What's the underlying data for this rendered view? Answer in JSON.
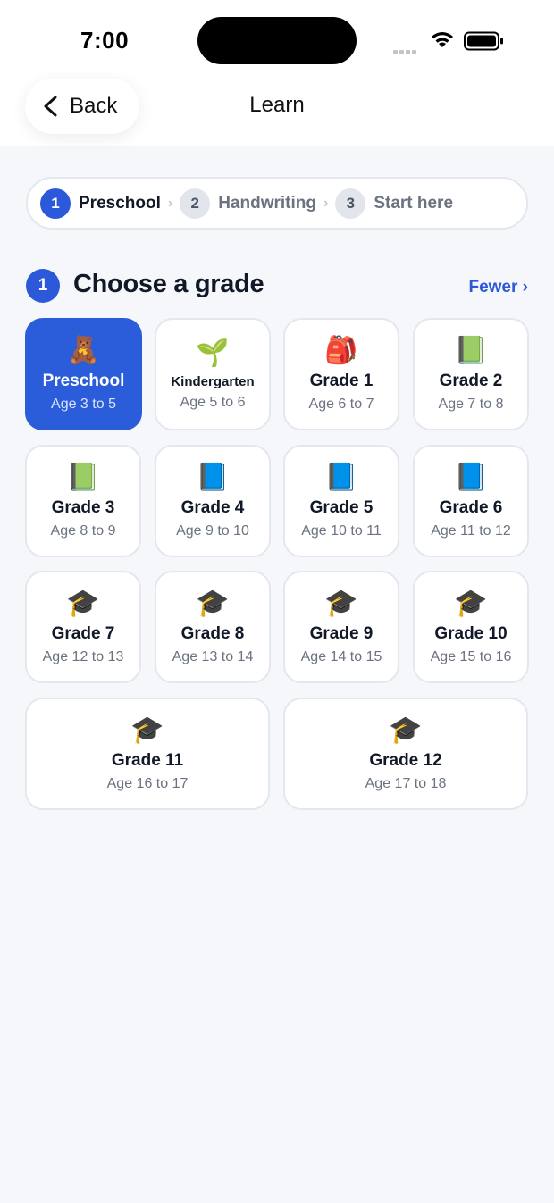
{
  "status": {
    "time": "7:00"
  },
  "nav": {
    "back_label": "Back",
    "title": "Learn"
  },
  "stepper": [
    {
      "num": "1",
      "label": "Preschool",
      "active": true
    },
    {
      "num": "2",
      "label": "Handwriting",
      "active": false
    },
    {
      "num": "3",
      "label": "Start here",
      "active": false
    }
  ],
  "section": {
    "num": "1",
    "title": "Choose a grade",
    "toggle_label": "Fewer ›"
  },
  "accent_color": "#2b5ddb",
  "grades": [
    {
      "icon": "🧸",
      "icon_name": "teddy-bear-icon",
      "name": "Preschool",
      "age": "Age 3 to 5",
      "selected": true
    },
    {
      "icon": "🌱",
      "icon_name": "seedling-icon",
      "name": "Kindergarten",
      "age": "Age 5 to 6",
      "selected": false
    },
    {
      "icon": "🎒",
      "icon_name": "backpack-icon",
      "name": "Grade 1",
      "age": "Age 6 to 7",
      "selected": false
    },
    {
      "icon": "📗",
      "icon_name": "green-book-icon",
      "name": "Grade 2",
      "age": "Age 7 to 8",
      "selected": false
    },
    {
      "icon": "📗",
      "icon_name": "green-book-icon",
      "name": "Grade 3",
      "age": "Age 8 to 9",
      "selected": false
    },
    {
      "icon": "📘",
      "icon_name": "blue-book-icon",
      "name": "Grade 4",
      "age": "Age 9 to 10",
      "selected": false
    },
    {
      "icon": "📘",
      "icon_name": "blue-book-icon",
      "name": "Grade 5",
      "age": "Age 10 to 11",
      "selected": false
    },
    {
      "icon": "📘",
      "icon_name": "blue-book-icon",
      "name": "Grade 6",
      "age": "Age 11 to 12",
      "selected": false
    },
    {
      "icon": "🎓",
      "icon_name": "graduation-cap-icon",
      "name": "Grade 7",
      "age": "Age 12 to 13",
      "selected": false
    },
    {
      "icon": "🎓",
      "icon_name": "graduation-cap-icon",
      "name": "Grade 8",
      "age": "Age 13 to 14",
      "selected": false
    },
    {
      "icon": "🎓",
      "icon_name": "graduation-cap-icon",
      "name": "Grade 9",
      "age": "Age 14 to 15",
      "selected": false
    },
    {
      "icon": "🎓",
      "icon_name": "graduation-cap-icon",
      "name": "Grade 10",
      "age": "Age 15 to 16",
      "selected": false
    },
    {
      "icon": "🎓",
      "icon_name": "graduation-cap-icon",
      "name": "Grade 11",
      "age": "Age 16 to 17",
      "selected": false
    },
    {
      "icon": "🎓",
      "icon_name": "graduation-cap-icon",
      "name": "Grade 12",
      "age": "Age 17 to 18",
      "selected": false
    }
  ]
}
